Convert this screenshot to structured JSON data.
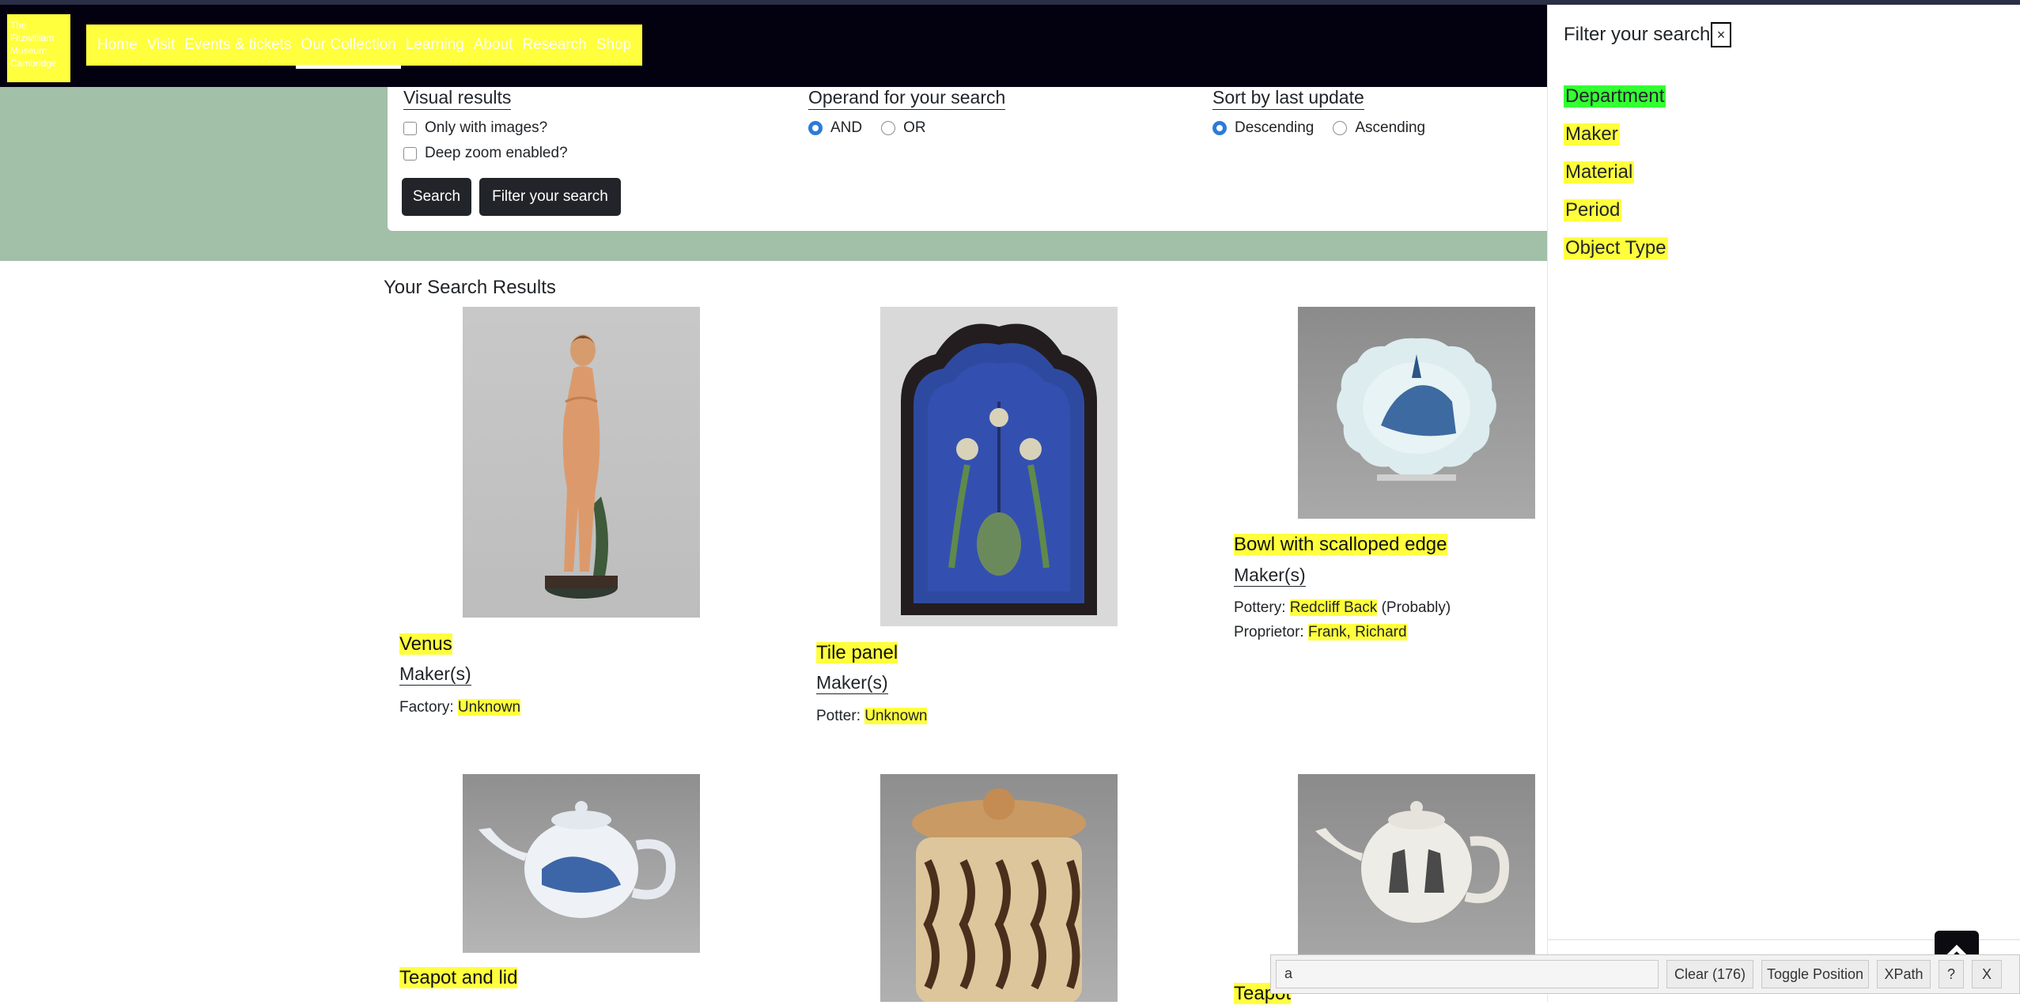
{
  "logo": {
    "lines": [
      "The",
      "Fitzwilliam",
      "Museum",
      "Cambridge"
    ]
  },
  "nav": {
    "items": [
      "Home",
      "Visit",
      "Events & tickets",
      "Our Collection",
      "Learning",
      "About",
      "Research",
      "Shop"
    ],
    "active": "Our Collection"
  },
  "search_options": {
    "visual": {
      "title": "Visual results",
      "only_images": "Only with images?",
      "deep_zoom": "Deep zoom enabled?"
    },
    "operand": {
      "title": "Operand for your search",
      "and": "AND",
      "or": "OR",
      "selected": "AND"
    },
    "sort": {
      "title": "Sort by last update",
      "desc": "Descending",
      "asc": "Ascending",
      "selected": "Descending"
    },
    "search_button": "Search",
    "filter_button": "Filter your search"
  },
  "results": {
    "title": "Your Search Results",
    "cards": [
      {
        "title": "Venus",
        "maker_heading": "Maker(s)",
        "lines": [
          {
            "role": "Factory:",
            "name": "Unknown",
            "suffix": ""
          }
        ]
      },
      {
        "title": "Tile panel",
        "maker_heading": "Maker(s)",
        "lines": [
          {
            "role": "Potter:",
            "name": "Unknown",
            "suffix": ""
          }
        ]
      },
      {
        "title": "Bowl with scalloped edge",
        "maker_heading": "Maker(s)",
        "lines": [
          {
            "role": "Pottery:",
            "name": "Redcliff Back",
            "suffix": " (Probably)"
          },
          {
            "role": "Proprietor:",
            "name": "Frank, Richard",
            "suffix": ""
          }
        ]
      },
      {
        "title": "Teapot and lid"
      },
      {
        "title": ""
      },
      {
        "title": "Teapot"
      }
    ]
  },
  "sidebar": {
    "title": "Filter your search",
    "close": "×",
    "facets": [
      "Department",
      "Maker",
      "Material",
      "Period",
      "Object Type"
    ]
  },
  "xpath_tool": {
    "input_value": "a",
    "clear": "Clear (176)",
    "toggle": "Toggle Position",
    "xpath": "XPath",
    "help": "?",
    "close": "X"
  },
  "colors": {
    "highlight": "#ffff3d",
    "department_highlight": "#33ff33",
    "navbar": "#03010f",
    "band": "#a2bfa8"
  }
}
